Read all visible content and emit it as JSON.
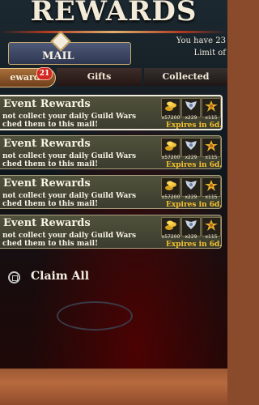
{
  "header": {
    "title": "REWARDS",
    "info_top": "You have 23",
    "info_bottom": "Limit of"
  },
  "mail": {
    "label": "MAIL"
  },
  "tabs": [
    {
      "label": "ewards",
      "badge": "21"
    },
    {
      "label": "Gifts"
    },
    {
      "label": "Collected"
    }
  ],
  "mails": [
    {
      "title": "Event Rewards",
      "desc_line1": "not collect your daily Guild Wars",
      "desc_line2": "ched them to this mail!",
      "rewards": [
        "x57200",
        "x229",
        "x115"
      ],
      "expires": "Expires in 6d."
    },
    {
      "title": "Event Rewards",
      "desc_line1": "not collect your daily Guild Wars",
      "desc_line2": "ched them to this mail!",
      "rewards": [
        "x57200",
        "x229",
        "x115"
      ],
      "expires": "Expires in 6d."
    },
    {
      "title": "Event Rewards",
      "desc_line1": "not collect your daily Guild Wars",
      "desc_line2": "ched them to this mail!",
      "rewards": [
        "x57200",
        "x229",
        "x115"
      ],
      "expires": "Expires in 6d."
    },
    {
      "title": "Event Rewards",
      "desc_line1": "not collect your daily Guild Wars",
      "desc_line2": "ched them to this mail!",
      "rewards": [
        "x57200",
        "x229",
        "x115"
      ],
      "expires": "Expires in 6d."
    }
  ],
  "reward_icons": [
    "gold-coins-icon",
    "silver-wings-icon",
    "gold-star-badge-icon"
  ],
  "claim": {
    "label": "Claim All"
  },
  "colors": {
    "accent": "#f4c230",
    "badge": "#d22822"
  }
}
